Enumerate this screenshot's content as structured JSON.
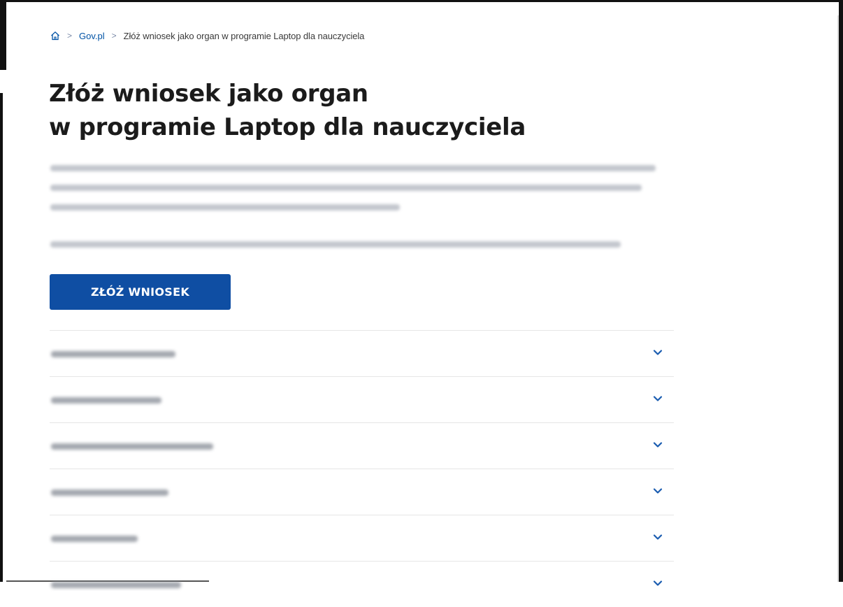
{
  "breadcrumb": {
    "home_icon": "home-icon",
    "separator": ">",
    "items": [
      {
        "label": "Gov.pl"
      },
      {
        "label": "Złóż wniosek jako organ w programie Laptop dla nauczyciela"
      }
    ]
  },
  "page": {
    "title_line1": "Złóż wniosek jako organ",
    "title_line2": "w programie Laptop dla nauczyciela"
  },
  "actions": {
    "submit_label": "ZŁÓŻ WNIOSEK"
  },
  "accordion": {
    "icon": "chevron-down-icon",
    "item_count": 6
  },
  "colors": {
    "primary": "#0f4ea3",
    "link": "#0052a5",
    "chevron": "#1a5cb0"
  }
}
